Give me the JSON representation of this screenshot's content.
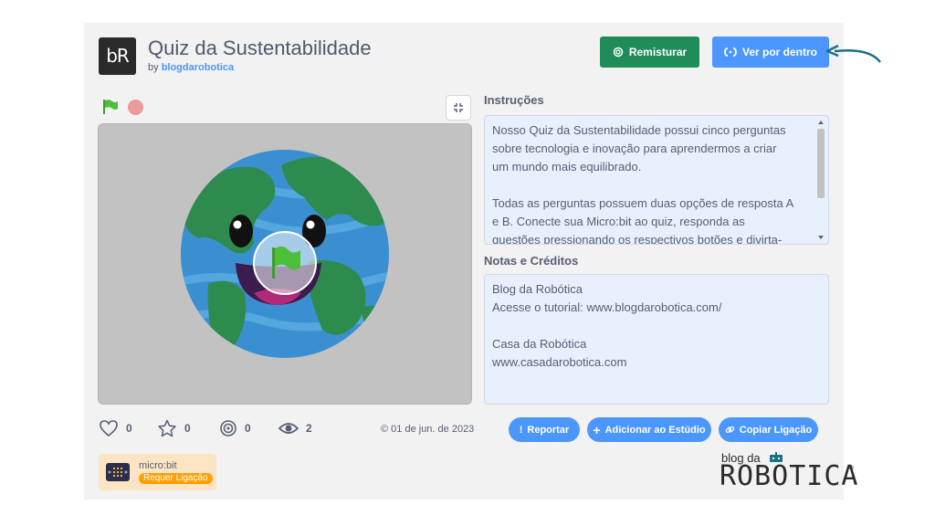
{
  "project": {
    "logo_text": "bR",
    "title": "Quiz da Sustentabilidade",
    "by_prefix": "by",
    "author": "blogdarobotica"
  },
  "header_buttons": {
    "remix_label": "Remisturar",
    "see_inside_label": "Ver por dentro"
  },
  "instructions": {
    "title": "Instruções",
    "lines_p1": [
      "Nosso Quiz da Sustentabilidade possui cinco perguntas",
      "sobre tecnologia e inovação para aprendermos a criar",
      "um mundo mais equilibrado."
    ],
    "lines_p2": [
      "Todas as perguntas possuem duas opções de resposta A",
      "e B. Conecte sua Micro:bit ao quiz, responda as",
      "questões pressionando os respectivos botões e divirta-"
    ]
  },
  "notes": {
    "title": "Notas e Créditos",
    "lines_p1": [
      "Blog da Robótica",
      "Acesse o tutorial: www.blogdarobotica.com/"
    ],
    "lines_p2": [
      "Casa da Robótica",
      "www.casadarobotica.com"
    ]
  },
  "stats": {
    "loves": "0",
    "favorites": "0",
    "remixes": "0",
    "views": "2"
  },
  "date": "© 01 de jun. de 2023",
  "actions": {
    "report_label": "Reportar",
    "add_studio_label": "Adicionar ao Estúdio",
    "copy_link_label": "Copiar Ligação"
  },
  "extension": {
    "name": "micro:bit",
    "badge": "Requer Ligação"
  },
  "brand": {
    "top": "blog da",
    "main": "ROBOTICA",
    "reg": "®"
  },
  "colors": {
    "remix_green": "#208c57",
    "scratch_blue": "#4c97ff",
    "stage_gray": "#c2c2c2",
    "textbox_bg": "#e8f0fd",
    "ocean": "#3a8fd1",
    "land": "#2e8b4e"
  },
  "icons": {
    "green_flag": "green-flag-icon",
    "stop": "stop-icon",
    "fullscreen": "fullscreen-icon",
    "remix": "remix-icon",
    "see_inside": "see-inside-icon",
    "love": "heart-icon",
    "favorite": "star-icon",
    "remix_count": "spiral-icon",
    "views": "eye-icon"
  }
}
